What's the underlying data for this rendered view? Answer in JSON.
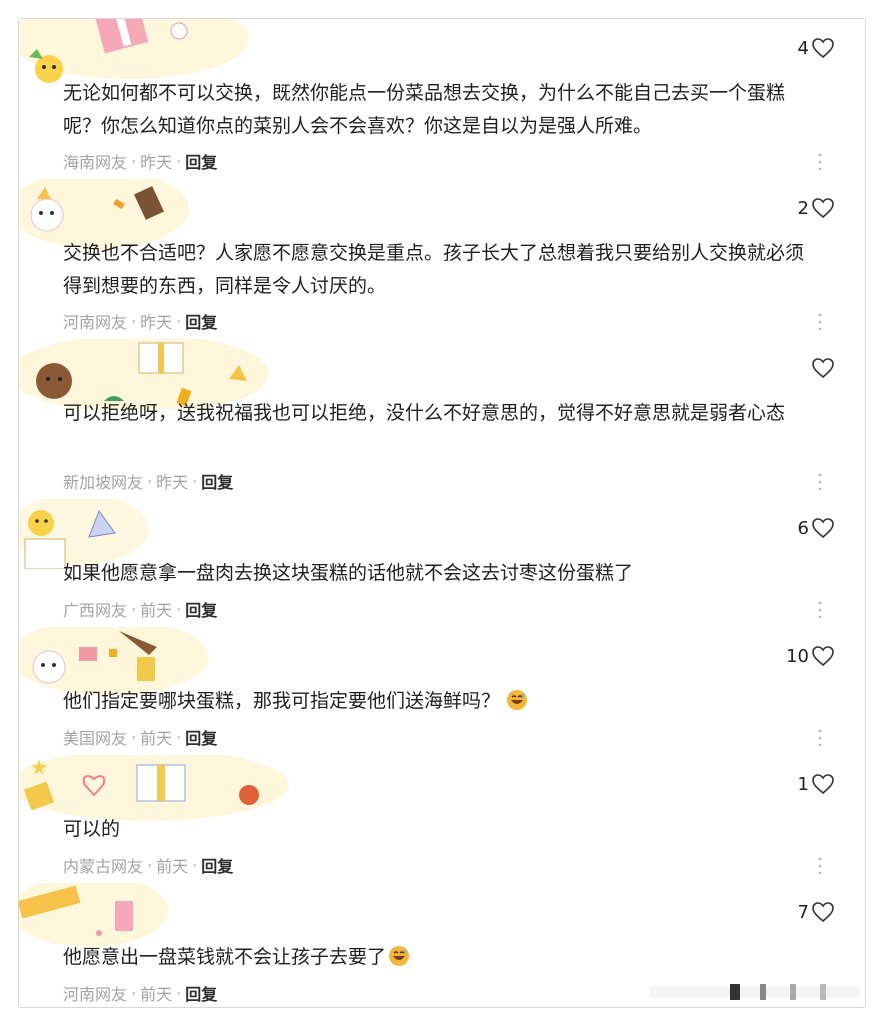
{
  "comments": [
    {
      "likes": "4",
      "text": "无论如何都不可以交换，既然你能点一份菜品想去交换，为什么不能自己去买一个蛋糕呢？你怎么知道你点的菜别人会不会喜欢？你这是自以为是强人所难。",
      "region": "海南网友",
      "time": "昨天",
      "reply": "回复"
    },
    {
      "likes": "2",
      "text": "交换也不合适吧？人家愿不愿意交换是重点。孩子长大了总想着我只要给别人交换就必须得到想要的东西，同样是令人讨厌的。",
      "region": "河南网友",
      "time": "昨天",
      "reply": "回复"
    },
    {
      "likes": "",
      "text": "可以拒绝呀，送我祝福我也可以拒绝，没什么不好意思的，觉得不好意思就是弱者心态",
      "region": "新加坡网友",
      "time": "昨天",
      "reply": "回复"
    },
    {
      "likes": "6",
      "text": "如果他愿意拿一盘肉去换这块蛋糕的话他就不会这去讨枣这份蛋糕了",
      "region": "广西网友",
      "time": "前天",
      "reply": "回复"
    },
    {
      "likes": "10",
      "text": "他们指定要哪块蛋糕，那我可指定要他们送海鲜吗？",
      "region": "美国网友",
      "time": "前天",
      "reply": "回复"
    },
    {
      "likes": "1",
      "text": "可以的",
      "region": "内蒙古网友",
      "time": "前天",
      "reply": "回复"
    },
    {
      "likes": "7",
      "text": "他愿意出一盘菜钱就不会让孩子去要了",
      "region": "河南网友",
      "time": "前天",
      "reply": "回复"
    }
  ],
  "icons": {
    "like": "heart-outline-icon",
    "more": "vertical-ellipsis-icon",
    "emoji": "grinning-sweat-emoji",
    "decoration": "party-sticker-decoration"
  },
  "colors": {
    "text": "#1f1f1f",
    "meta": "#a3a3a3",
    "reply": "#2e2e2e",
    "emoji": "#f3b53a"
  }
}
